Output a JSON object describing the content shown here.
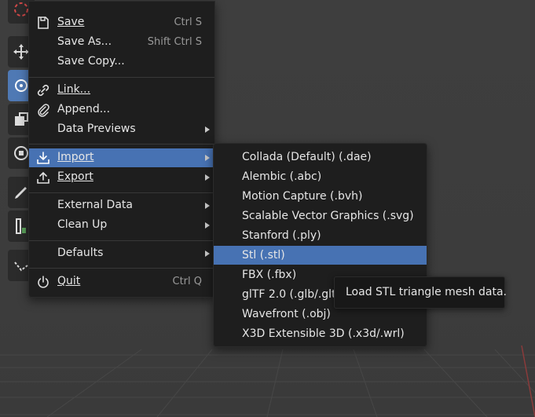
{
  "file_menu": {
    "save": {
      "label": "Save",
      "shortcut": "Ctrl S"
    },
    "save_as": {
      "label": "Save As...",
      "shortcut": "Shift Ctrl S"
    },
    "save_copy": {
      "label": "Save Copy..."
    },
    "link": {
      "label": "Link..."
    },
    "append": {
      "label": "Append..."
    },
    "data_previews": {
      "label": "Data Previews"
    },
    "import": {
      "label": "Import"
    },
    "export": {
      "label": "Export"
    },
    "external_data": {
      "label": "External Data"
    },
    "clean_up": {
      "label": "Clean Up"
    },
    "defaults": {
      "label": "Defaults"
    },
    "quit": {
      "label": "Quit",
      "shortcut": "Ctrl Q"
    }
  },
  "import_submenu": {
    "items": [
      {
        "label": "Collada (Default) (.dae)"
      },
      {
        "label": "Alembic (.abc)"
      },
      {
        "label": "Motion Capture (.bvh)"
      },
      {
        "label": "Scalable Vector Graphics (.svg)"
      },
      {
        "label": "Stanford (.ply)"
      },
      {
        "label": "Stl (.stl)",
        "highlighted": true
      },
      {
        "label": "FBX (.fbx)"
      },
      {
        "label": "glTF 2.0 (.glb/.gltf)"
      },
      {
        "label": "Wavefront (.obj)"
      },
      {
        "label": "X3D Extensible 3D (.x3d/.wrl)"
      }
    ]
  },
  "tooltip": {
    "text": "Load STL triangle mesh data."
  },
  "colors": {
    "highlight": "#4772b3",
    "menu_bg": "#1e1e1e",
    "viewport_bg": "#3d3d3d"
  }
}
